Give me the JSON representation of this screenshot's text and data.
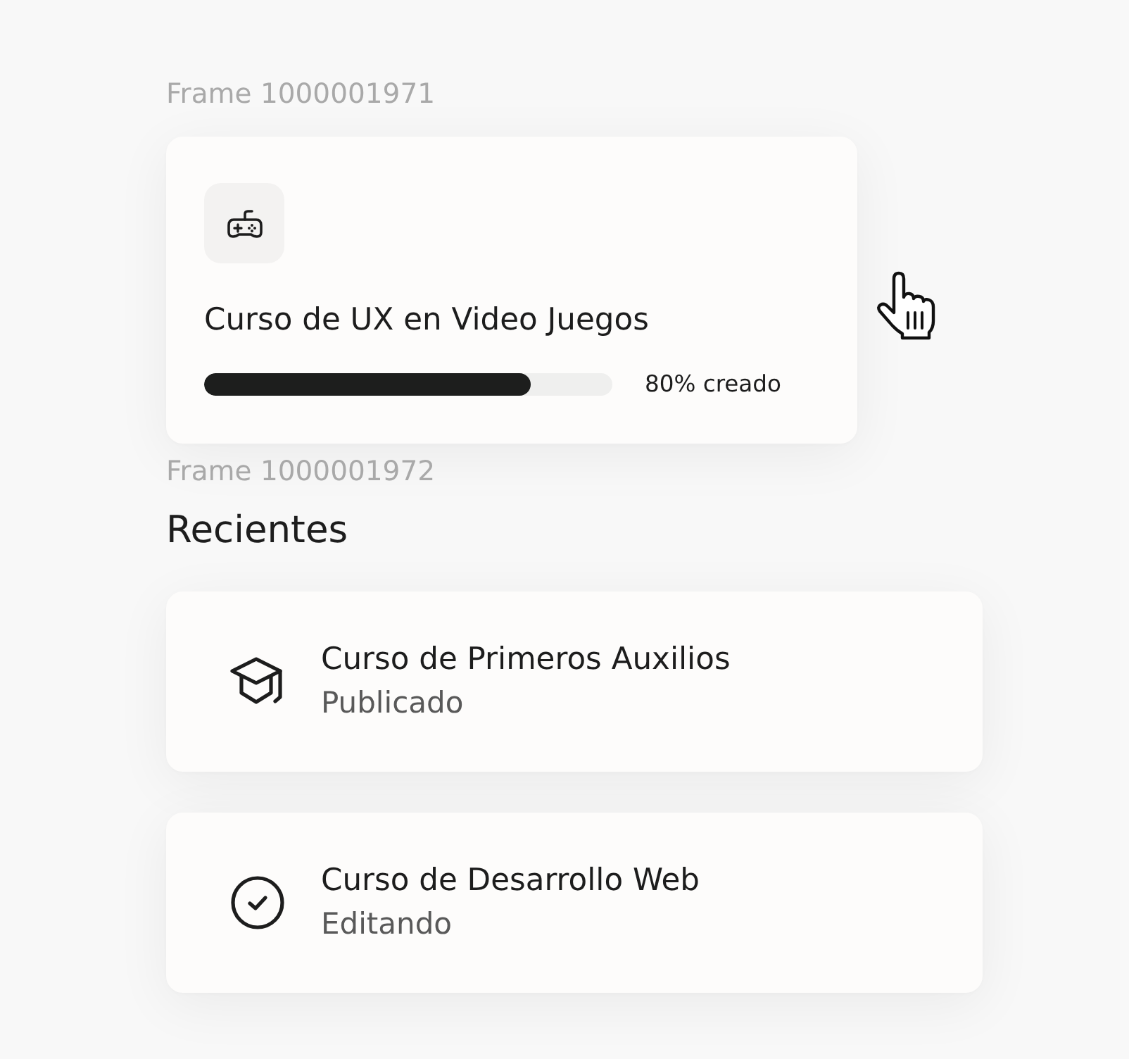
{
  "current": {
    "frame_label": "Frame 1000001971",
    "title": "Curso de UX en Video Juegos",
    "progress": {
      "level": 0.8,
      "label": "80% creado"
    }
  },
  "recent": {
    "frame_label": "Frame 1000001972",
    "heading": "Recientes",
    "items": [
      {
        "kind": "published",
        "title": "Curso de Primeros Auxilios",
        "status": "Publicado"
      },
      {
        "kind": "editing",
        "title": "Curso de Desarrollo Web",
        "status": "Editando"
      }
    ]
  }
}
